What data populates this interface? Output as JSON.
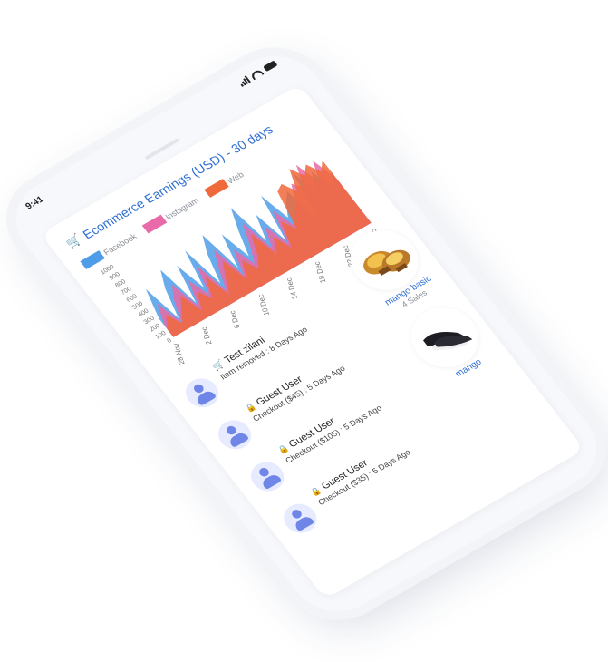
{
  "status_bar": {
    "time": "9:41"
  },
  "card": {
    "title": "Ecommerce Earnings (USD) - 30 days",
    "title_icon": "cart-icon"
  },
  "legend": [
    {
      "label": "Facebook",
      "color": "#4f9de8"
    },
    {
      "label": "Instagram",
      "color": "#e86aa8"
    },
    {
      "label": "Web",
      "color": "#f0693b"
    }
  ],
  "chart_data": {
    "type": "area",
    "x_tick_labels": [
      "28 Nov",
      "2 Dec",
      "6 Dec",
      "10 Dec",
      "14 Dec",
      "18 Dec",
      "22 Dec",
      "28 Dec"
    ],
    "y_tick_labels": [
      "1000",
      "900",
      "800",
      "700",
      "600",
      "500",
      "400",
      "300",
      "200",
      "100",
      "0"
    ],
    "ylim": [
      0,
      1000
    ],
    "series": [
      {
        "name": "Facebook",
        "color": "#4f9de8",
        "values": [
          250,
          600,
          150,
          500,
          700,
          200,
          650,
          300,
          750,
          250,
          600,
          800,
          300,
          700,
          350,
          650,
          900,
          400,
          700,
          300,
          850,
          500,
          650,
          750,
          300,
          900,
          600,
          800,
          550,
          700
        ]
      },
      {
        "name": "Instagram",
        "color": "#e86aa8",
        "values": [
          150,
          400,
          100,
          350,
          500,
          150,
          450,
          200,
          550,
          150,
          400,
          600,
          200,
          500,
          250,
          450,
          700,
          300,
          550,
          250,
          650,
          400,
          500,
          600,
          800,
          700,
          950,
          650,
          900,
          600
        ]
      },
      {
        "name": "Web",
        "color": "#f0693b",
        "values": [
          100,
          250,
          80,
          220,
          350,
          100,
          300,
          150,
          400,
          100,
          280,
          450,
          150,
          350,
          180,
          320,
          550,
          220,
          400,
          200,
          500,
          350,
          800,
          850,
          700,
          950,
          800,
          900,
          750,
          850
        ]
      }
    ]
  },
  "activity": [
    {
      "name": "Test zilani",
      "icon": "cart-icon",
      "detail": "Item removed : 8 Days Ago",
      "has_avatar": true
    },
    {
      "name": "Guest User",
      "icon": "lock-icon",
      "detail": "Checkout ($45) : 5 Days Ago",
      "has_avatar": true
    },
    {
      "name": "Guest User",
      "icon": "lock-icon",
      "detail": "Checkout ($105) : 5 Days Ago",
      "has_avatar": true
    },
    {
      "name": "Guest User",
      "icon": "lock-icon",
      "detail": "Checkout ($35) : 5 Days Ago",
      "has_avatar": true
    }
  ],
  "products": [
    {
      "name": "mango basic",
      "sales": "4 Sales",
      "image": "shoes-gold-icon"
    },
    {
      "name": "mango",
      "sales": "",
      "image": "shoes-black-icon"
    }
  ]
}
